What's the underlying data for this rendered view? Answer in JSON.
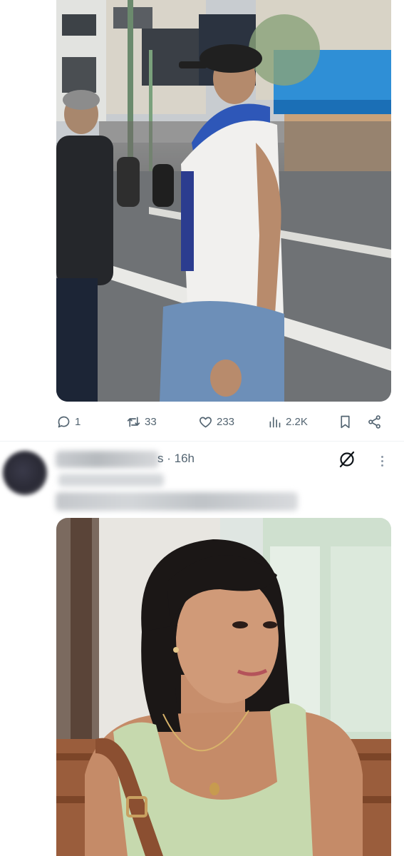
{
  "post1": {
    "media": {
      "alt_icon": "photo-street"
    },
    "actions": {
      "replies": "1",
      "reposts": "33",
      "likes": "233",
      "views": "2.2K"
    }
  },
  "post2": {
    "time_separator": "s · ",
    "time": "16h",
    "media": {
      "alt_icon": "photo-portrait"
    }
  },
  "colors": {
    "icon": "#536471",
    "divider": "#eff3f4",
    "background": "#ffffff"
  }
}
